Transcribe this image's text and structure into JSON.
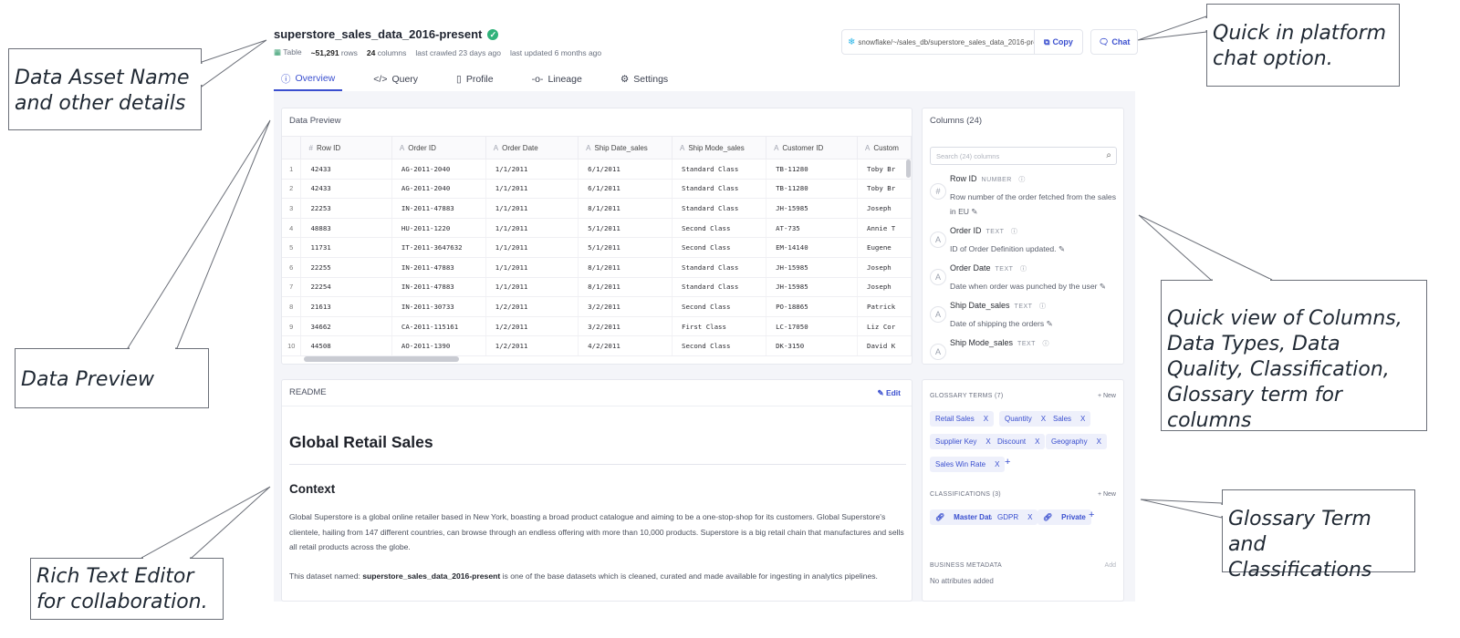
{
  "callouts": {
    "data_asset": "Data Asset Name and other details",
    "data_preview": "Data Preview",
    "rich_text": "Rich Text Editor for collaboration.",
    "chat": "Quick in platform chat option.",
    "columns": "Quick view of Columns, Data Types, Data Quality, Classification, Glossary term for columns",
    "glossary": "Glossary Term and Classifications"
  },
  "asset": {
    "name": "superstore_sales_data_2016-present",
    "type": "Table",
    "rows": "~51,291",
    "rows_label": "rows",
    "columns": "24",
    "columns_label": "columns",
    "crawled": "last crawled 23 days ago",
    "updated": "last updated 6 months ago"
  },
  "actions": {
    "path": "snowflake/~/sales_db/superstore_sales_data_2016-pres...",
    "copy": "Copy",
    "chat": "Chat"
  },
  "tabs": [
    {
      "icon": "ⓘ",
      "label": "Overview"
    },
    {
      "icon": "</>",
      "label": "Query"
    },
    {
      "icon": "▯",
      "label": "Profile"
    },
    {
      "icon": "-o-",
      "label": "Lineage"
    },
    {
      "icon": "⚙",
      "label": "Settings"
    }
  ],
  "preview": {
    "title": "Data Preview",
    "headers": [
      {
        "type": "#",
        "label": "Row ID"
      },
      {
        "type": "A",
        "label": "Order ID"
      },
      {
        "type": "A",
        "label": "Order Date"
      },
      {
        "type": "A",
        "label": "Ship Date_sales"
      },
      {
        "type": "A",
        "label": "Ship Mode_sales"
      },
      {
        "type": "A",
        "label": "Customer ID"
      },
      {
        "type": "A",
        "label": "Custom"
      }
    ],
    "rows": [
      [
        "1",
        "42433",
        "AG-2011-2040",
        "1/1/2011",
        "6/1/2011",
        "Standard Class",
        "TB-11280",
        "Toby Br"
      ],
      [
        "2",
        "42433",
        "AG-2011-2040",
        "1/1/2011",
        "6/1/2011",
        "Standard Class",
        "TB-11280",
        "Toby Br"
      ],
      [
        "3",
        "22253",
        "IN-2011-47883",
        "1/1/2011",
        "8/1/2011",
        "Standard Class",
        "JH-15985",
        "Joseph"
      ],
      [
        "4",
        "48883",
        "HU-2011-1220",
        "1/1/2011",
        "5/1/2011",
        "Second Class",
        "AT-735",
        "Annie T"
      ],
      [
        "5",
        "11731",
        "IT-2011-3647632",
        "1/1/2011",
        "5/1/2011",
        "Second Class",
        "EM-14140",
        "Eugene"
      ],
      [
        "6",
        "22255",
        "IN-2011-47883",
        "1/1/2011",
        "8/1/2011",
        "Standard Class",
        "JH-15985",
        "Joseph"
      ],
      [
        "7",
        "22254",
        "IN-2011-47883",
        "1/1/2011",
        "8/1/2011",
        "Standard Class",
        "JH-15985",
        "Joseph"
      ],
      [
        "8",
        "21613",
        "IN-2011-30733",
        "1/2/2011",
        "3/2/2011",
        "Second Class",
        "PO-18865",
        "Patrick"
      ],
      [
        "9",
        "34662",
        "CA-2011-115161",
        "1/2/2011",
        "3/2/2011",
        "First Class",
        "LC-17050",
        "Liz Cor"
      ],
      [
        "10",
        "44508",
        "AO-2011-1390",
        "1/2/2011",
        "4/2/2011",
        "Second Class",
        "DK-3150",
        "David K"
      ]
    ]
  },
  "columns_panel": {
    "title": "Columns (24)",
    "search_placeholder": "Search (24) columns",
    "items": [
      {
        "icon": "#",
        "name": "Row ID",
        "type": "NUMBER",
        "desc": "Row number of the order fetched from the sales in EU"
      },
      {
        "icon": "A",
        "name": "Order ID",
        "type": "TEXT",
        "desc": "ID of Order Definition updated."
      },
      {
        "icon": "A",
        "name": "Order Date",
        "type": "TEXT",
        "desc": "Date when order was punched by the user"
      },
      {
        "icon": "A",
        "name": "Ship Date_sales",
        "type": "TEXT",
        "desc": "Date of shipping the orders"
      },
      {
        "icon": "A",
        "name": "Ship Mode_sales",
        "type": "TEXT",
        "desc": ""
      }
    ]
  },
  "readme": {
    "label": "README",
    "edit": "Edit",
    "h1": "Global Retail Sales",
    "h2": "Context",
    "p1": "Global Superstore is a global online retailer based in New York, boasting a broad product catalogue and aiming to be a one-stop-shop for its customers. Global Superstore's clientele, hailing from 147 different countries, can browse through an endless offering with more than 10,000 products. Superstore is a big retail chain that manufactures and sells all retail products across the globe.",
    "p2_prefix": "This dataset named: ",
    "p2_bold": "superstore_sales_data_2016-present",
    "p2_suffix": " is one of the base datasets which is cleaned, curated and made available for ingesting in analytics pipelines."
  },
  "glossary": {
    "terms_label": "GLOSSARY TERMS (7)",
    "new": "+ New",
    "terms": [
      "Retail Sales",
      "Quantity",
      "Sales",
      "Supplier Key",
      "Discount",
      "Geography",
      "Sales Win Rate"
    ],
    "class_label": "CLASSIFICATIONS (3)",
    "classifications": [
      "Master Data",
      "GDPR",
      "Private"
    ],
    "bm_label": "BUSINESS METADATA",
    "bm_add": "Add",
    "bm_empty": "No attributes added"
  },
  "colors": {
    "accent": "#3a4fcf",
    "verified": "#30b27a",
    "chip_bg": "#eef0fb"
  }
}
